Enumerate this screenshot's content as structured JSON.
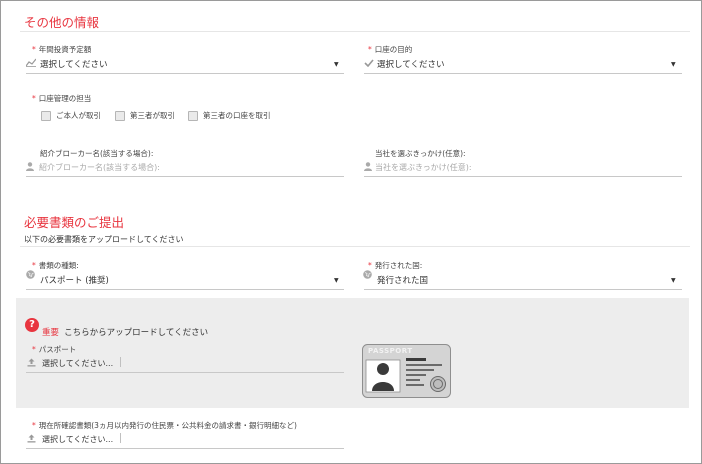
{
  "other_info": {
    "title": "その他の情報",
    "annual_investment": {
      "label": "年間投資予定額",
      "value": "選択してください"
    },
    "account_purpose": {
      "label": "口座の目的",
      "value": "選択してください"
    },
    "account_manager": {
      "label": "口座管理の担当",
      "options": [
        "ご本人が取引",
        "第三者が取引",
        "第三者の口座を取引"
      ]
    },
    "broker_name": {
      "label": "紹介ブローカー名(該当する場合):",
      "placeholder": "紹介ブローカー名(該当する場合):"
    },
    "reason": {
      "label": "当社を選ぶきっかけ(任意):",
      "placeholder": "当社を選ぶきっかけ(任意):"
    }
  },
  "documents": {
    "title": "必要書類のご提出",
    "subtitle": "以下の必要書類をアップロードしてください",
    "doc_type": {
      "label": "書類の種類:",
      "value": "パスポート (推奨)"
    },
    "issuing_country": {
      "label": "発行された国:",
      "value": "発行された国"
    },
    "important": {
      "badge": "?",
      "word": "重要",
      "text": "こちらからアップロードしてください"
    },
    "passport_upload": {
      "label": "パスポート",
      "value": "選択してください..."
    },
    "passport_card_text": "PASSPORT",
    "address_upload": {
      "label": "現在所確認書類(3ヵ月以内発行の住民票・公共料金の請求書・銀行明細など)",
      "value": "選択してください..."
    }
  },
  "colors": {
    "accent": "#e8353f",
    "panel": "#ededed"
  },
  "icons": [
    "chart-icon",
    "check-icon",
    "user-icon",
    "globe-icon",
    "upload-icon",
    "caret-down-icon",
    "question-icon",
    "passport-icon"
  ]
}
